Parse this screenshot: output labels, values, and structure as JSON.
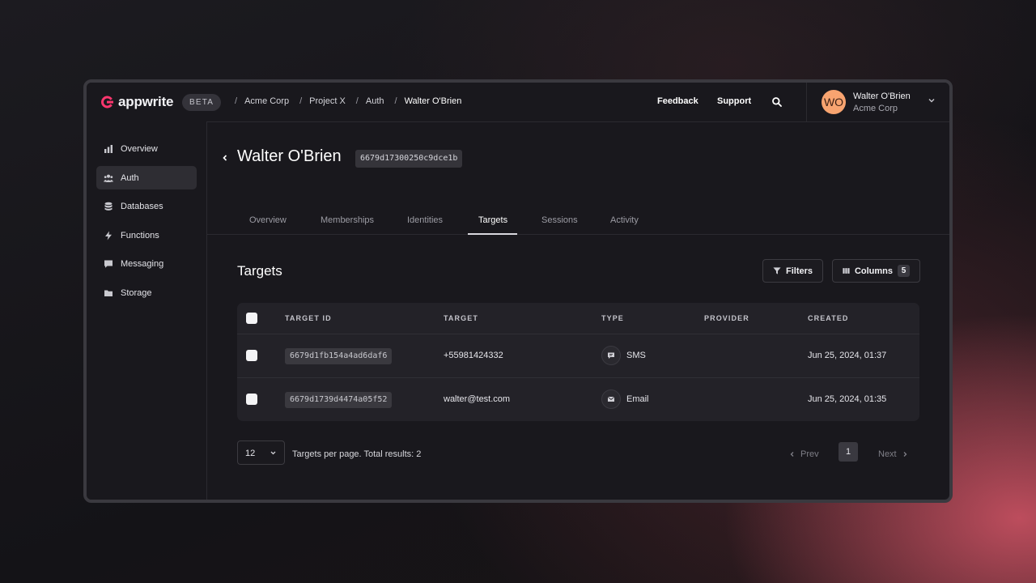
{
  "app": {
    "name": "appwrite",
    "badge": "BETA"
  },
  "breadcrumbs": [
    "Acme Corp",
    "Project X",
    "Auth",
    "Walter O'Brien"
  ],
  "header": {
    "feedback": "Feedback",
    "support": "Support",
    "search_icon": "search-icon"
  },
  "user": {
    "initials": "WO",
    "name": "Walter O'Brien",
    "org": "Acme Corp",
    "avatar_color": "#f8a470"
  },
  "sidebar": {
    "items": [
      {
        "label": "Overview",
        "icon": "bar-chart-icon"
      },
      {
        "label": "Auth",
        "icon": "users-icon",
        "active": true
      },
      {
        "label": "Databases",
        "icon": "database-icon"
      },
      {
        "label": "Functions",
        "icon": "lightning-icon"
      },
      {
        "label": "Messaging",
        "icon": "chat-icon"
      },
      {
        "label": "Storage",
        "icon": "folder-icon"
      }
    ]
  },
  "page": {
    "title": "Walter O'Brien",
    "user_id": "6679d17300250c9dce1b"
  },
  "tabs": [
    "Overview",
    "Memberships",
    "Identities",
    "Targets",
    "Sessions",
    "Activity"
  ],
  "active_tab": "Targets",
  "section": {
    "title": "Targets",
    "filters_label": "Filters",
    "columns_label": "Columns",
    "columns_count": "5"
  },
  "table": {
    "headers": [
      "TARGET ID",
      "TARGET",
      "TYPE",
      "PROVIDER",
      "CREATED"
    ],
    "rows": [
      {
        "id": "6679d1fb154a4ad6daf6",
        "target": "+55981424332",
        "type": "SMS",
        "provider": "",
        "created": "Jun 25, 2024, 01:37"
      },
      {
        "id": "6679d1739d4474a05f52",
        "target": "walter@test.com",
        "type": "Email",
        "provider": "",
        "created": "Jun 25, 2024, 01:35"
      }
    ]
  },
  "pagination": {
    "per_page": "12",
    "summary": "Targets per page. Total results: 2",
    "prev": "Prev",
    "next": "Next",
    "current_page": "1"
  },
  "colors": {
    "accent": "#fd366e",
    "background": "#19181d"
  }
}
